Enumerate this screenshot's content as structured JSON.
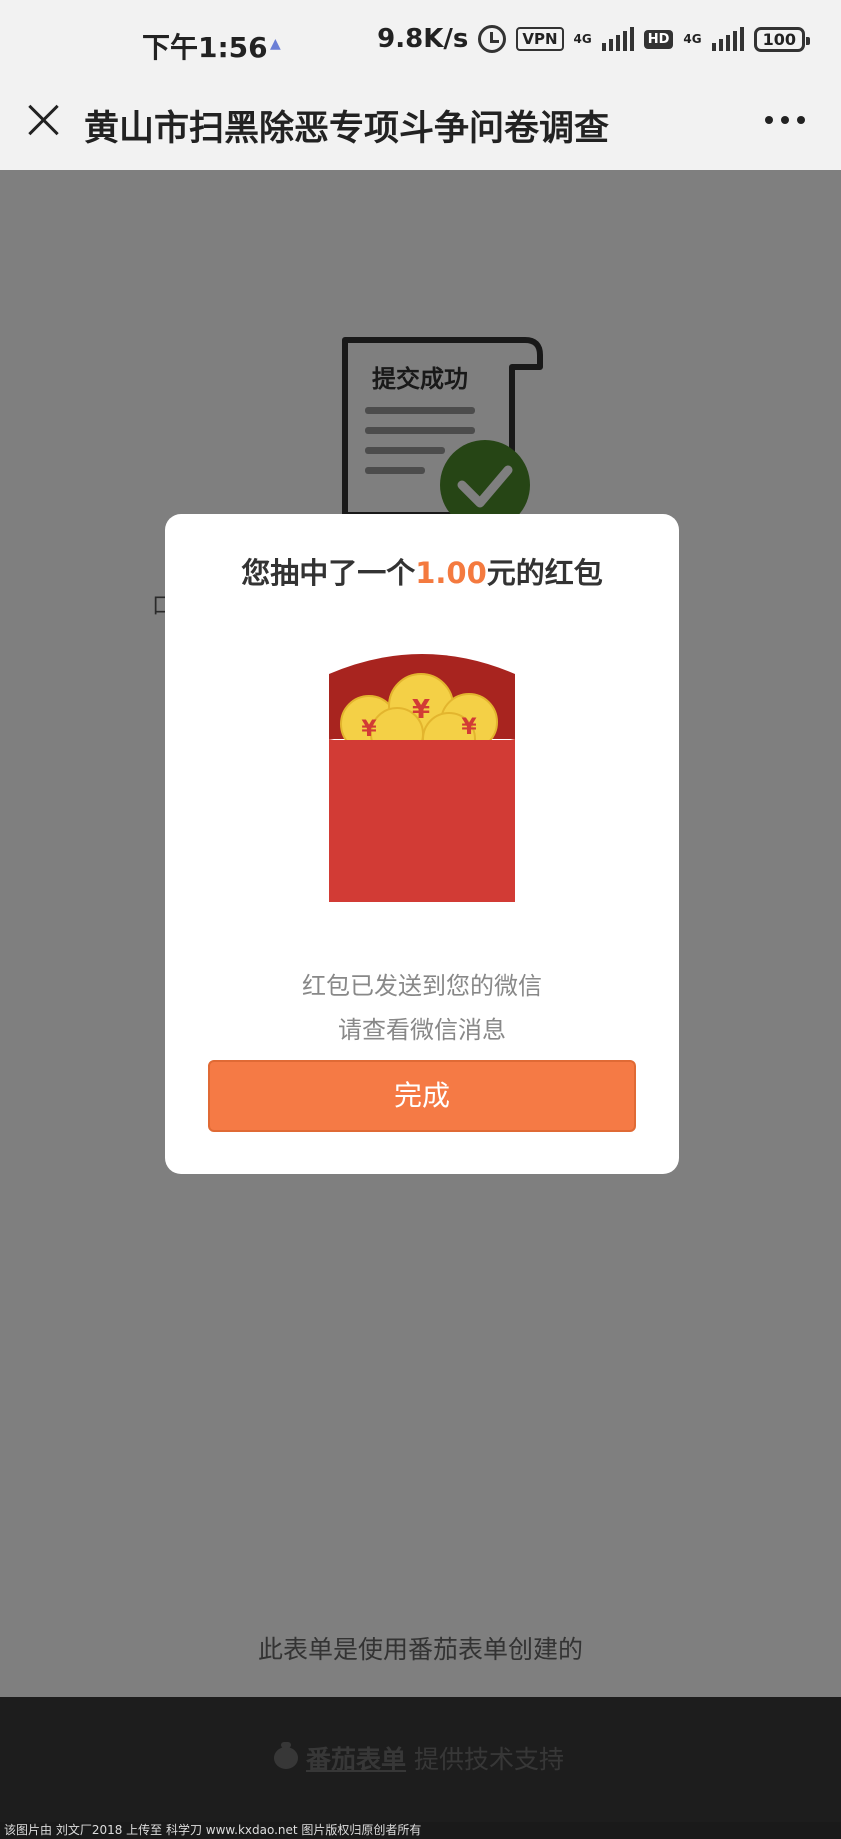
{
  "status_bar": {
    "time": "下午1:56",
    "speed": "9.8K/s",
    "vpn": "VPN",
    "net1": "4G",
    "hd": "HD",
    "net2": "4G",
    "battery": "100",
    "icons": [
      "alarm-icon",
      "signal-icon",
      "battery-icon"
    ]
  },
  "header": {
    "title": "黄山市扫黑除恶专项斗争问卷调查",
    "icons": [
      "close-icon",
      "more-icon"
    ]
  },
  "background_page": {
    "illustration_label": "提交成功",
    "peek_text": "口",
    "footer_text": "此表单是使用番茄表单创建的",
    "brand_name": "番茄表单",
    "support_text": "提供技术支持"
  },
  "modal": {
    "title_prefix": "您抽中了一个",
    "amount": "1.00",
    "title_suffix": "元的红包",
    "message_line1": "红包已发送到您的微信",
    "message_line2": "请查看微信消息",
    "done_label": "完成",
    "coin_symbol": "¥"
  },
  "watermark": "该图片由 刘文厂2018 上传至 科学刀 www.kxdao.net 图片版权归原创者所有",
  "colors": {
    "accent": "#f57a45",
    "red_packet": "#d23b35",
    "coin": "#f4d046",
    "check": "#4c8a2b"
  }
}
